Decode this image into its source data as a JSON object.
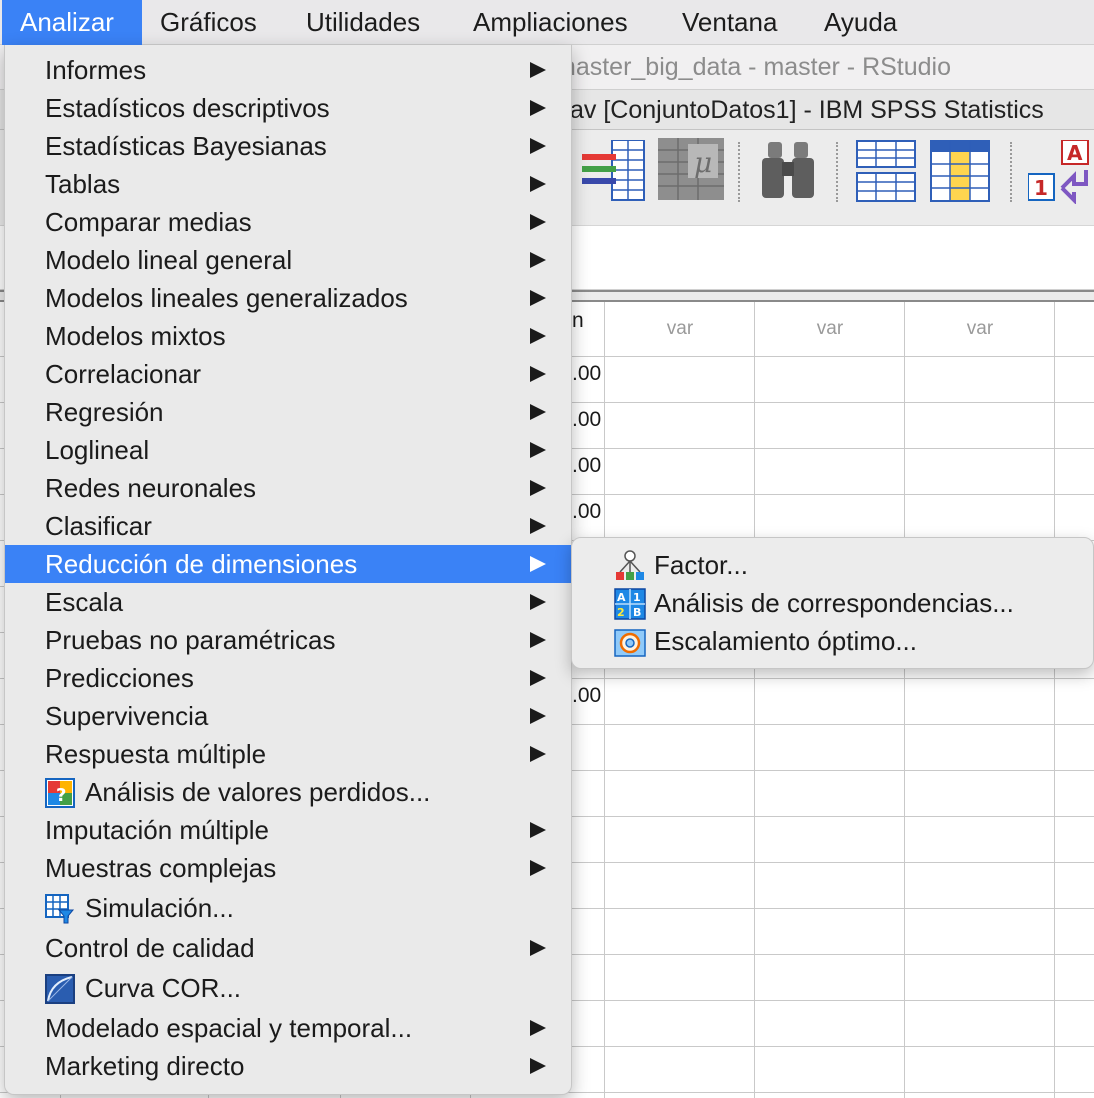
{
  "menubar": {
    "items": [
      "Analizar",
      "Gráficos",
      "Utilidades",
      "Ampliaciones",
      "Ventana",
      "Ayuda"
    ],
    "active": "Analizar"
  },
  "background": {
    "rstudio_title": "master_big_data - master - RStudio",
    "spss_title": "av [ConjuntoDatos1] - IBM SPSS Statistics",
    "grid": {
      "headers": [
        "n",
        "var",
        "var",
        "var"
      ],
      "values": [
        ".00",
        ".00",
        ".00",
        ".00",
        ".00"
      ]
    }
  },
  "analyze_menu": {
    "items": [
      {
        "label": "Informes",
        "submenu": true
      },
      {
        "label": "Estadísticos descriptivos",
        "submenu": true
      },
      {
        "label": "Estadísticas Bayesianas",
        "submenu": true
      },
      {
        "label": "Tablas",
        "submenu": true
      },
      {
        "label": "Comparar medias",
        "submenu": true
      },
      {
        "label": "Modelo lineal general",
        "submenu": true
      },
      {
        "label": "Modelos lineales generalizados",
        "submenu": true
      },
      {
        "label": "Modelos mixtos",
        "submenu": true
      },
      {
        "label": "Correlacionar",
        "submenu": true
      },
      {
        "label": "Regresión",
        "submenu": true
      },
      {
        "label": "Loglineal",
        "submenu": true
      },
      {
        "label": "Redes neuronales",
        "submenu": true
      },
      {
        "label": "Clasificar",
        "submenu": true
      },
      {
        "label": "Reducción de dimensiones",
        "submenu": true,
        "highlighted": true
      },
      {
        "label": "Escala",
        "submenu": true
      },
      {
        "label": "Pruebas no paramétricas",
        "submenu": true
      },
      {
        "label": "Predicciones",
        "submenu": true
      },
      {
        "label": "Supervivencia",
        "submenu": true
      },
      {
        "label": "Respuesta múltiple",
        "submenu": true
      },
      {
        "label": "Análisis de valores perdidos...",
        "icon": "missing-values-icon"
      },
      {
        "label": "Imputación múltiple",
        "submenu": true
      },
      {
        "label": "Muestras complejas",
        "submenu": true
      },
      {
        "label": "Simulación...",
        "icon": "simulation-icon"
      },
      {
        "label": "Control de calidad",
        "submenu": true
      },
      {
        "label": "Curva COR...",
        "icon": "roc-curve-icon"
      },
      {
        "label": "Modelado espacial y temporal...",
        "submenu": true
      },
      {
        "label": "Marketing directo",
        "submenu": true
      }
    ]
  },
  "submenu": {
    "items": [
      {
        "label": "Factor...",
        "icon": "factor-icon"
      },
      {
        "label": "Análisis de correspondencias...",
        "icon": "correspondence-icon"
      },
      {
        "label": "Escalamiento óptimo...",
        "icon": "optimal-scaling-icon"
      }
    ]
  },
  "colors": {
    "highlight": "#3a82f6",
    "menu_bg": "#eaeaea"
  }
}
